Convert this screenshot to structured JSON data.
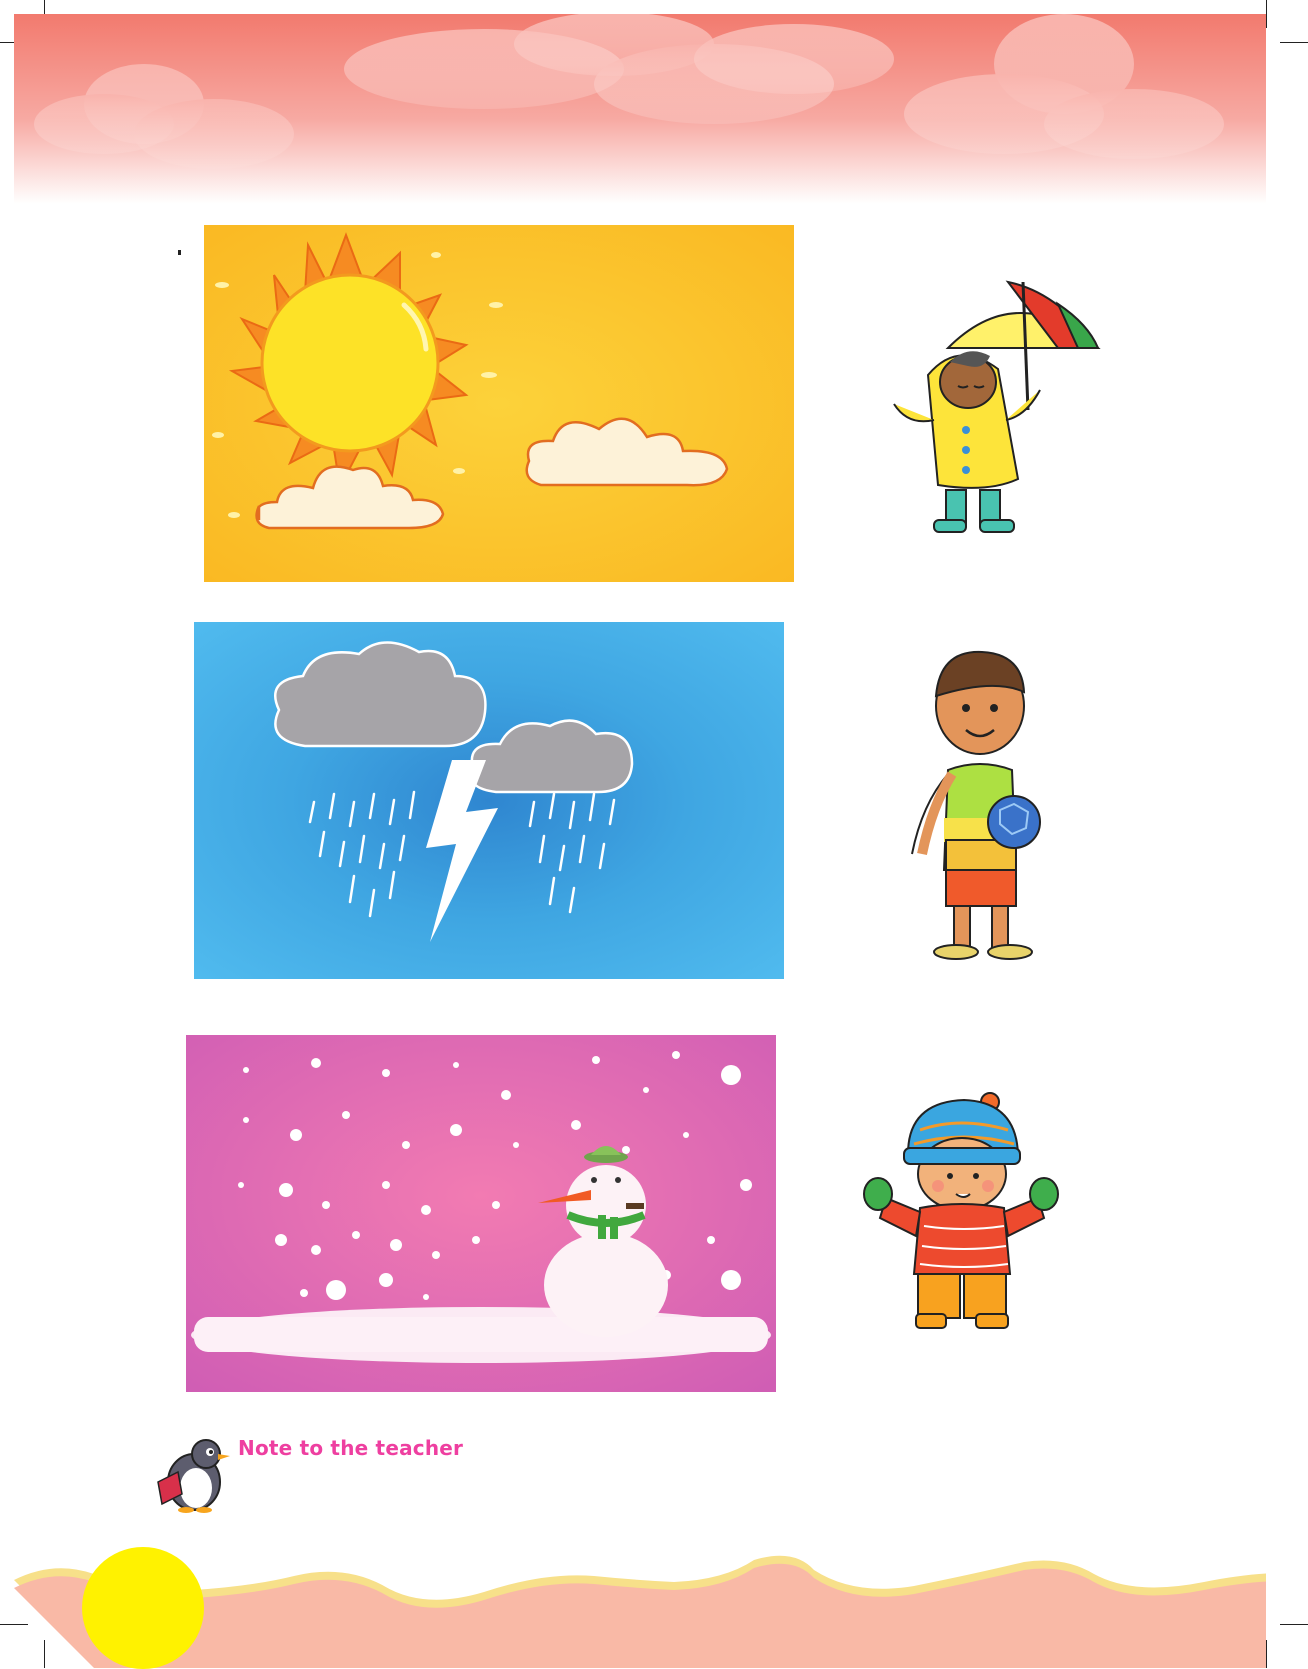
{
  "note": {
    "label": "Note to the teacher"
  },
  "panels": [
    {
      "scene": "sunny",
      "icon": "sun-icon"
    },
    {
      "scene": "rainy",
      "icon": "thunderstorm-icon"
    },
    {
      "scene": "snowy",
      "icon": "snowman-icon"
    }
  ],
  "children": [
    {
      "outfit": "raincoat and umbrella",
      "icon": "child-raincoat-icon"
    },
    {
      "outfit": "vest and shorts with ball",
      "icon": "child-summer-icon"
    },
    {
      "outfit": "woolen cap and sweater",
      "icon": "child-winter-icon"
    }
  ],
  "colors": {
    "header": "#f2837a",
    "sunny_bg": "#fbc52a",
    "rainy_bg": "#3fb2e8",
    "snowy_bg": "#ee76b3",
    "note_text": "#ee3fa0",
    "footer_wave": "#f9b9a6",
    "footer_sun": "#fff200"
  }
}
